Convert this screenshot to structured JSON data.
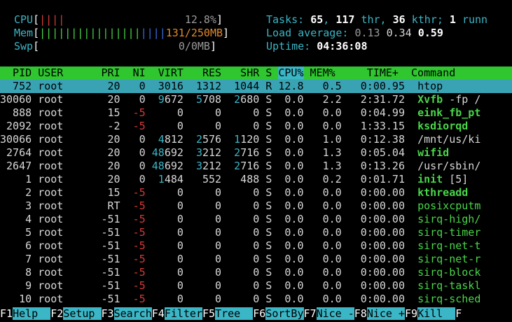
{
  "meters": {
    "cpu": {
      "label": "CPU",
      "bars_green": "",
      "bars_red": "||||",
      "value": "12.8%"
    },
    "mem": {
      "label": "Mem",
      "bars_green": "||||||||||||||||",
      "bars_blue": "||||",
      "bars_orange": "",
      "value": "131/250MB"
    },
    "swp": {
      "label": "Swp",
      "value": "0/0MB"
    }
  },
  "summary": {
    "tasks_label": "Tasks: ",
    "tasks": "65",
    "thr": "117",
    "thr_label": " thr, ",
    "kthr": "36",
    "kthr_label": " kthr; ",
    "running": "1",
    "running_label": " runn",
    "load_label": "Load average: ",
    "load1": "0.13",
    "load5": "0.34",
    "load15": "0.59",
    "uptime_label": "Uptime: ",
    "uptime": "04:36:08"
  },
  "columns": [
    "PID",
    "USER",
    "PRI",
    "NI",
    "VIRT",
    "RES",
    "SHR",
    "S",
    "CPU%",
    "MEM%",
    "TIME+",
    "Command"
  ],
  "processes": [
    {
      "pid": "752",
      "user": "root",
      "pri": "20",
      "ni": "0",
      "virt": "3016",
      "res": "1312",
      "shr": "1044",
      "s": "R",
      "cpu": "12.8",
      "mem": "0.5",
      "time": "0:00.95",
      "cmd": "htop",
      "args": ""
    },
    {
      "pid": "30060",
      "user": "root",
      "pri": "20",
      "ni": "0",
      "virt": "9672",
      "res": "5708",
      "shr": "2680",
      "s": "S",
      "cpu": "0.0",
      "mem": "2.2",
      "time": "2:31.72",
      "cmd": "Xvfb",
      "args": " -fp /"
    },
    {
      "pid": "888",
      "user": "root",
      "pri": "15",
      "ni": "-5",
      "virt": "0",
      "res": "0",
      "shr": "0",
      "s": "S",
      "cpu": "0.0",
      "mem": "0.0",
      "time": "0:04.99",
      "cmd": "eink_fb_pt",
      "args": ""
    },
    {
      "pid": "2092",
      "user": "root",
      "pri": "-2",
      "ni": "-5",
      "virt": "0",
      "res": "0",
      "shr": "0",
      "s": "S",
      "cpu": "0.0",
      "mem": "0.0",
      "time": "1:33.15",
      "cmd": "ksdiorqd",
      "args": ""
    },
    {
      "pid": "30066",
      "user": "root",
      "pri": "20",
      "ni": "0",
      "virt": "4812",
      "res": "2576",
      "shr": "1120",
      "s": "S",
      "cpu": "0.0",
      "mem": "1.0",
      "time": "0:12.38",
      "cmd": "",
      "args": "/mnt/us/ki"
    },
    {
      "pid": "2764",
      "user": "root",
      "pri": "20",
      "ni": "0",
      "virt": "48692",
      "res": "3212",
      "shr": "2716",
      "s": "S",
      "cpu": "0.0",
      "mem": "1.3",
      "time": "0:05.04",
      "cmd": "wifid",
      "args": ""
    },
    {
      "pid": "2647",
      "user": "root",
      "pri": "20",
      "ni": "0",
      "virt": "48692",
      "res": "3212",
      "shr": "2716",
      "s": "S",
      "cpu": "0.0",
      "mem": "1.3",
      "time": "0:13.26",
      "cmd": "",
      "args": "/usr/sbin/"
    },
    {
      "pid": "1",
      "user": "root",
      "pri": "20",
      "ni": "0",
      "virt": "1484",
      "res": "552",
      "shr": "488",
      "s": "S",
      "cpu": "0.0",
      "mem": "0.2",
      "time": "0:01.71",
      "cmd": "init",
      "args": " [5]"
    },
    {
      "pid": "2",
      "user": "root",
      "pri": "15",
      "ni": "-5",
      "virt": "0",
      "res": "0",
      "shr": "0",
      "s": "S",
      "cpu": "0.0",
      "mem": "0.0",
      "time": "0:00.00",
      "cmd": "kthreadd",
      "args": ""
    },
    {
      "pid": "3",
      "user": "root",
      "pri": "RT",
      "ni": "-5",
      "virt": "0",
      "res": "0",
      "shr": "0",
      "s": "S",
      "cpu": "0.0",
      "mem": "0.0",
      "time": "0:00.00",
      "cmd": "",
      "args": "",
      "kcmd": "posixcputm"
    },
    {
      "pid": "4",
      "user": "root",
      "pri": "-51",
      "ni": "-5",
      "virt": "0",
      "res": "0",
      "shr": "0",
      "s": "S",
      "cpu": "0.0",
      "mem": "0.0",
      "time": "0:00.00",
      "cmd": "",
      "args": "",
      "kcmd": "sirq-high/"
    },
    {
      "pid": "5",
      "user": "root",
      "pri": "-51",
      "ni": "-5",
      "virt": "0",
      "res": "0",
      "shr": "0",
      "s": "S",
      "cpu": "0.0",
      "mem": "0.0",
      "time": "0:00.00",
      "cmd": "",
      "args": "",
      "kcmd": "sirq-timer"
    },
    {
      "pid": "6",
      "user": "root",
      "pri": "-51",
      "ni": "-5",
      "virt": "0",
      "res": "0",
      "shr": "0",
      "s": "S",
      "cpu": "0.0",
      "mem": "0.0",
      "time": "0:00.00",
      "cmd": "",
      "args": "",
      "kcmd": "sirq-net-t"
    },
    {
      "pid": "7",
      "user": "root",
      "pri": "-51",
      "ni": "-5",
      "virt": "0",
      "res": "0",
      "shr": "0",
      "s": "S",
      "cpu": "0.0",
      "mem": "0.0",
      "time": "0:00.00",
      "cmd": "",
      "args": "",
      "kcmd": "sirq-net-r"
    },
    {
      "pid": "8",
      "user": "root",
      "pri": "-51",
      "ni": "-5",
      "virt": "0",
      "res": "0",
      "shr": "0",
      "s": "S",
      "cpu": "0.0",
      "mem": "0.0",
      "time": "0:00.00",
      "cmd": "",
      "args": "",
      "kcmd": "sirq-block"
    },
    {
      "pid": "9",
      "user": "root",
      "pri": "-51",
      "ni": "-5",
      "virt": "0",
      "res": "0",
      "shr": "0",
      "s": "S",
      "cpu": "0.0",
      "mem": "0.0",
      "time": "0:00.00",
      "cmd": "",
      "args": "",
      "kcmd": "sirq-taskl"
    },
    {
      "pid": "10",
      "user": "root",
      "pri": "-51",
      "ni": "-5",
      "virt": "0",
      "res": "0",
      "shr": "0",
      "s": "S",
      "cpu": "0.0",
      "mem": "0.0",
      "time": "0:00.00",
      "cmd": "",
      "args": "",
      "kcmd": "sirq-sched"
    }
  ],
  "fkeys": [
    {
      "key": "F1",
      "label": "Help  "
    },
    {
      "key": "F2",
      "label": "Setup "
    },
    {
      "key": "F3",
      "label": "Search"
    },
    {
      "key": "F4",
      "label": "Filter"
    },
    {
      "key": "F5",
      "label": "Tree  "
    },
    {
      "key": "F6",
      "label": "SortBy"
    },
    {
      "key": "F7",
      "label": "Nice -"
    },
    {
      "key": "F8",
      "label": "Nice +"
    },
    {
      "key": "F9",
      "label": "Kill  "
    },
    {
      "key": "F",
      "label": ""
    }
  ]
}
